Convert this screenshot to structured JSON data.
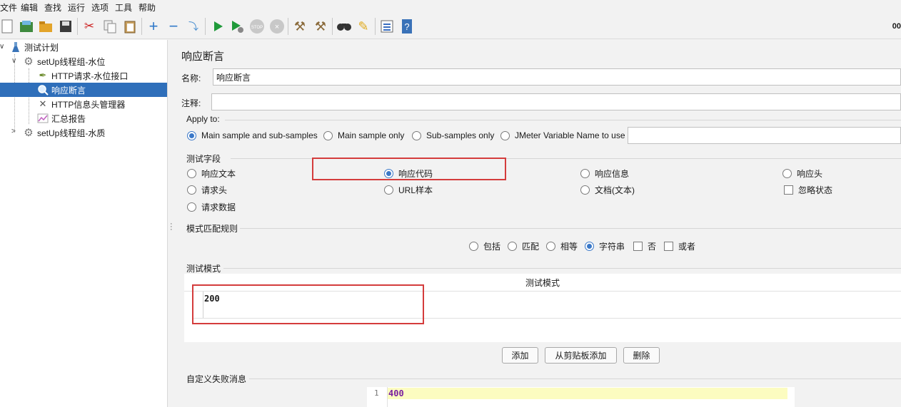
{
  "menu": [
    "文件",
    "编辑",
    "查找",
    "运行",
    "选项",
    "工具",
    "帮助"
  ],
  "toolbar": {
    "icons": [
      "new-icon",
      "templates-icon",
      "open-icon",
      "save-icon",
      "cut-icon",
      "copy-icon",
      "paste-icon",
      "expand-icon",
      "collapse-icon",
      "toggle-icon",
      "start-icon",
      "start-no-pause-icon",
      "stop-icon",
      "shutdown-icon",
      "clear-icon",
      "clear-all-icon",
      "search-icon",
      "reset-search-icon",
      "function-helper-icon",
      "help-icon"
    ],
    "counter": "00"
  },
  "tree": {
    "root": "测试计划",
    "group1": "setUp线程组-水位",
    "http_request": "HTTP请求-水位接口",
    "assertion": "响应断言",
    "header_manager": "HTTP信息头管理器",
    "summary": "汇总报告",
    "group2": "setUp线程组-水质"
  },
  "panel": {
    "title": "响应断言",
    "name_label": "名称:",
    "name_value": "响应断言",
    "comment_label": "注释:",
    "comment_value": "",
    "apply_to": {
      "title": "Apply to:",
      "options": [
        "Main sample and sub-samples",
        "Main sample only",
        "Sub-samples only",
        "JMeter Variable Name to use"
      ],
      "selected": "Main sample and sub-samples",
      "variable_value": ""
    },
    "test_field": {
      "title": "测试字段",
      "options": [
        "响应文本",
        "响应代码",
        "响应信息",
        "响应头",
        "请求头",
        "URL样本",
        "文档(文本)",
        "请求数据"
      ],
      "selected": "响应代码",
      "ignore_status_label": "忽略状态"
    },
    "match_rule": {
      "title": "模式匹配规则",
      "options": [
        "包括",
        "匹配",
        "相等",
        "字符串"
      ],
      "selected": "字符串",
      "not_label": "否",
      "or_label": "或者"
    },
    "patterns": {
      "title": "测试模式",
      "column_header": "测试模式",
      "rows": [
        "200"
      ]
    },
    "buttons": {
      "add": "添加",
      "add_clipboard": "从剪贴板添加",
      "delete": "删除"
    },
    "failure_message": {
      "title": "自定义失败消息",
      "line_number": "1",
      "value": "400"
    }
  }
}
